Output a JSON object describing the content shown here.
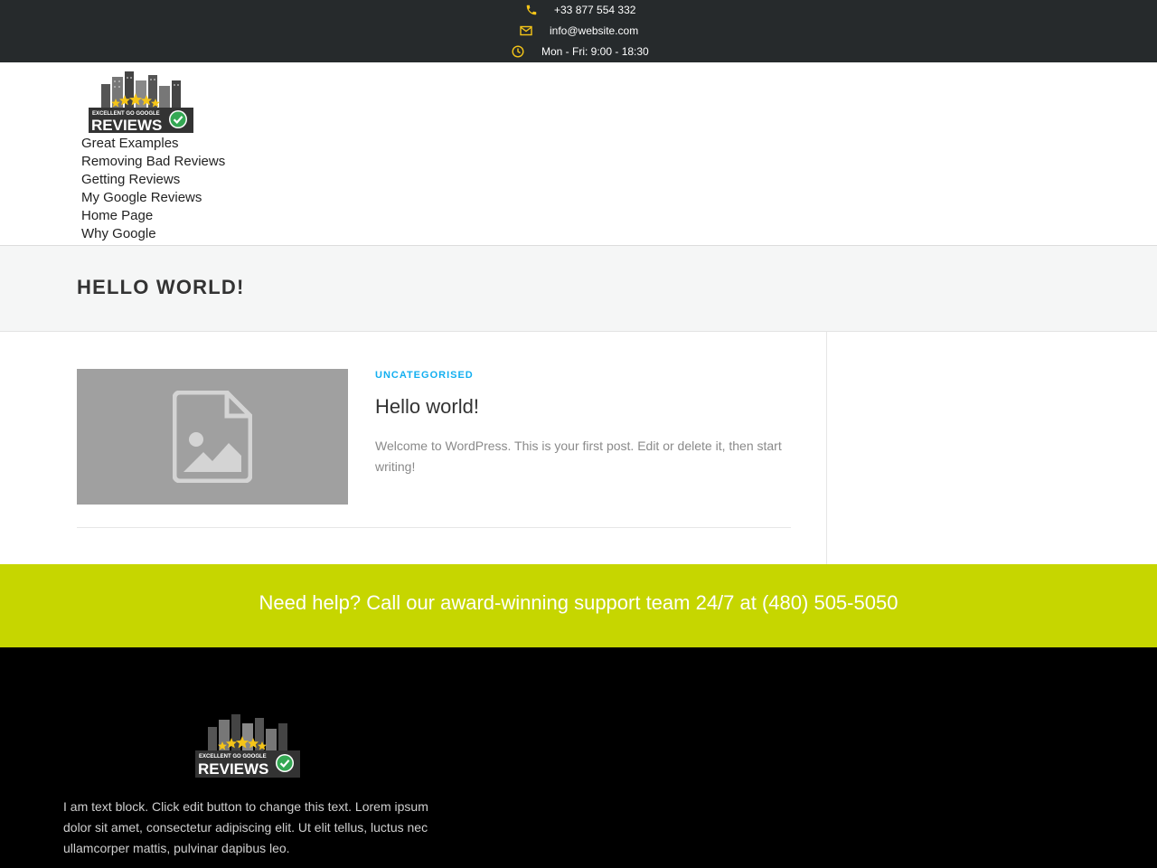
{
  "topbar": {
    "phone": "+33 877 554 332",
    "email": "info@website.com",
    "hours": "Mon - Fri: 9:00 - 18:30",
    "icon_color": "#f5c518"
  },
  "header": {
    "logo": {
      "line1": "EXCELLENT GO GOOGLE",
      "line2": "REVIEWS"
    },
    "nav": [
      "Great Examples",
      "Removing Bad Reviews",
      "Getting Reviews",
      "My Google Reviews",
      "Home Page",
      "Why Google"
    ]
  },
  "page_title": "HELLO WORLD!",
  "post": {
    "category": "UNCATEGORISED",
    "title": "Hello world!",
    "excerpt": "Welcome to WordPress. This is your first post. Edit or delete it, then start writing!"
  },
  "help_banner": {
    "text": "Need help? Call our award-winning support team 24/7 at (480) 505-5050",
    "color": "#c6d600"
  },
  "footer": {
    "text": "I am text block. Click edit button to change this text. Lorem ipsum dolor sit amet, consectetur adipiscing elit. Ut elit tellus, luctus nec ullamcorper mattis, pulvinar dapibus leo."
  },
  "colors": {
    "topbar_bg": "#262a2c",
    "category_accent": "#13aff0",
    "footer_bg": "#000000"
  }
}
